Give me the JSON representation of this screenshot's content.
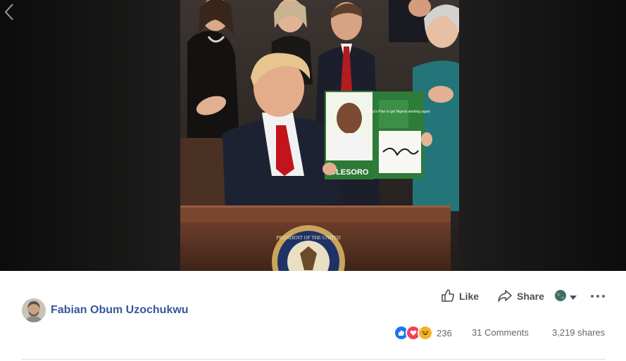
{
  "post": {
    "author_name": "Fabian Obum Uzochukwu",
    "reaction_count": "236",
    "comments": "31 Comments",
    "shares": "3,219 shares"
  },
  "actions": {
    "like_label": "Like",
    "share_label": "Share"
  },
  "icons": {
    "prev": "chevron-left-icon",
    "like": "thumbs-up-icon",
    "share": "share-arrow-icon",
    "audience": "globe-icon",
    "more": "more-dots-icon"
  },
  "colors": {
    "link_blue": "#365899",
    "like_blue": "#1877f2",
    "love_red": "#f33e58",
    "haha_yellow": "#f7b125",
    "secondary_text": "#616770"
  },
  "scene": {
    "flyer_title": "Atiku's Plan to get Nigeria working again",
    "flyer_name": "OLESORO",
    "seal_text": "PRESIDENT OF THE UNITED"
  }
}
